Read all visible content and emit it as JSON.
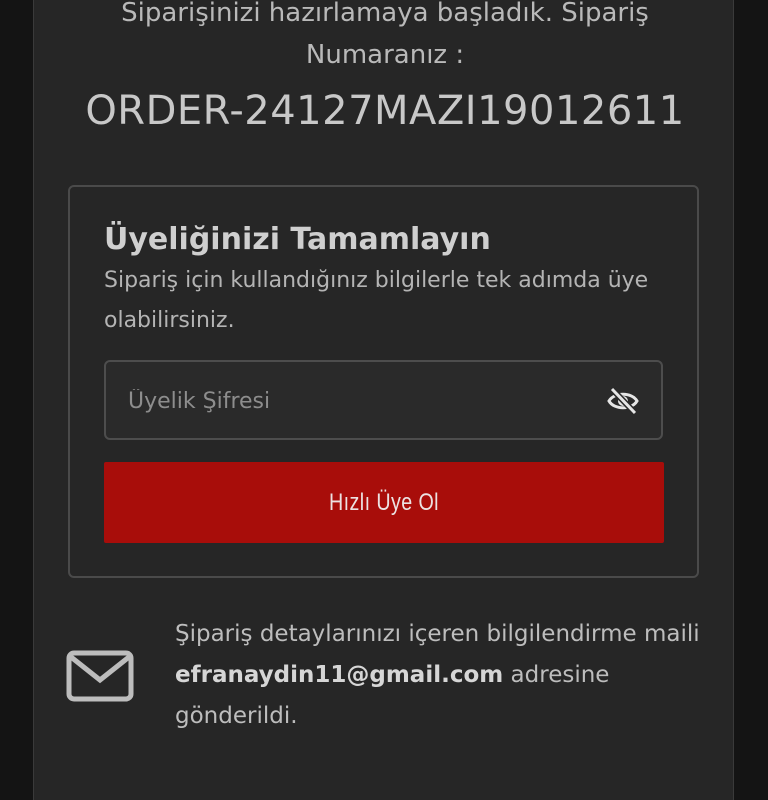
{
  "order": {
    "message": "Siparişinizi hazırlamaya başladık. Sipariş Numaranız :",
    "number": "ORDER-24127MAZI19012611"
  },
  "membership": {
    "title": "Üyeliğinizi Tamamlayın",
    "description": "Sipariş için kullandığınız bilgilerle tek adımda üye olabilirsiniz.",
    "password_placeholder": "Üyelik Şifresi",
    "password_value": "",
    "toggle_icon": "eye-slash-icon",
    "submit_label": "Hızlı Üye Ol",
    "submit_color": "#a80d0a"
  },
  "notification": {
    "icon": "envelope-icon",
    "text_before": "Şipariş detaylarınızı içeren bilgilendirme maili ",
    "email": "efranaydin11@gmail.com",
    "text_after": " adresine gönderildi."
  },
  "colors": {
    "background": "#141414",
    "card": "#262626",
    "accent": "#a80d0a"
  }
}
